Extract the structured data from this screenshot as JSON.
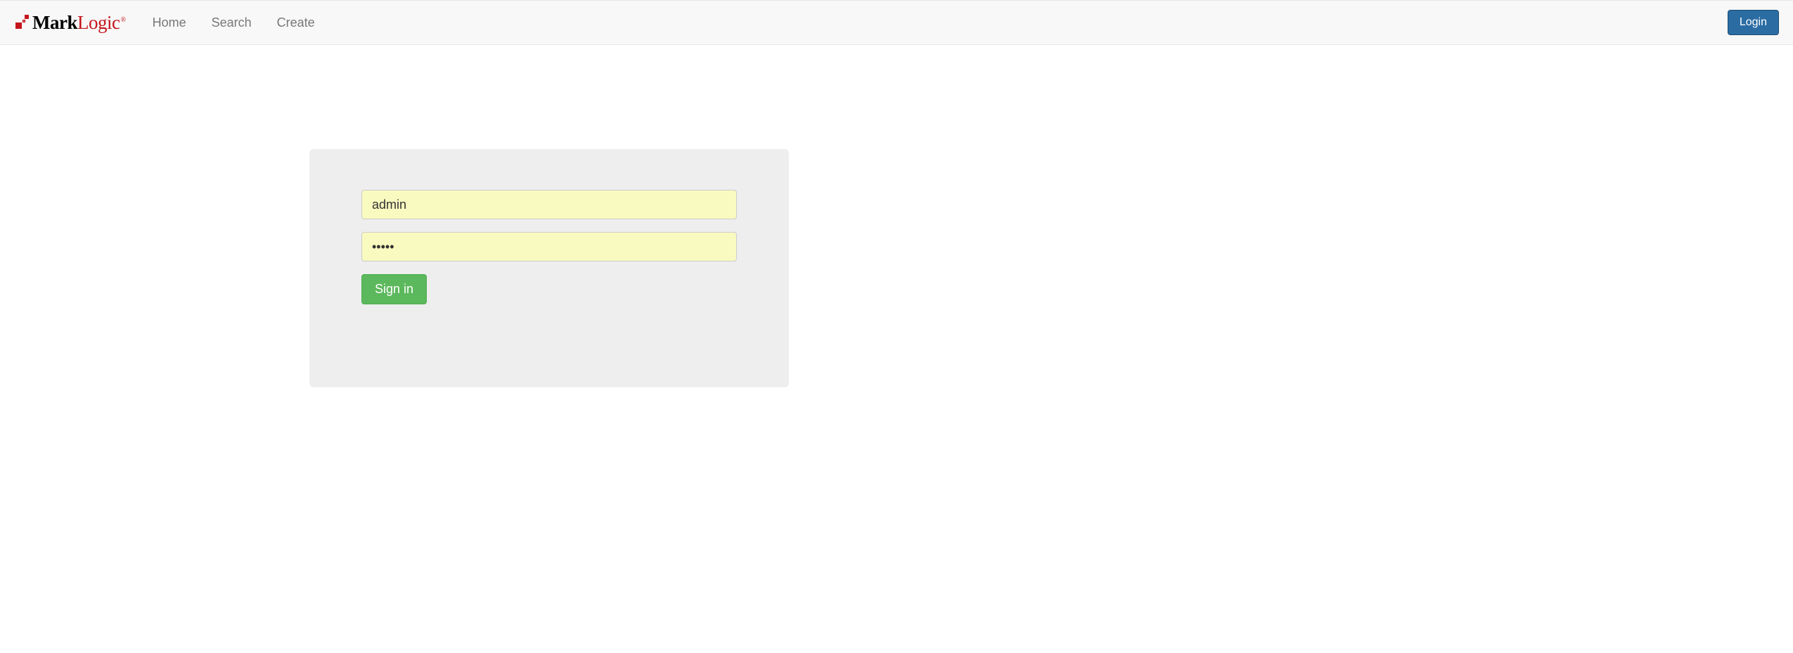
{
  "brand": {
    "part1": "Mark",
    "part2": "Logic",
    "reg": "®"
  },
  "nav": {
    "home": "Home",
    "search": "Search",
    "create": "Create"
  },
  "header": {
    "login": "Login"
  },
  "form": {
    "username_value": "admin",
    "password_value": "•••••",
    "signin": "Sign in"
  }
}
